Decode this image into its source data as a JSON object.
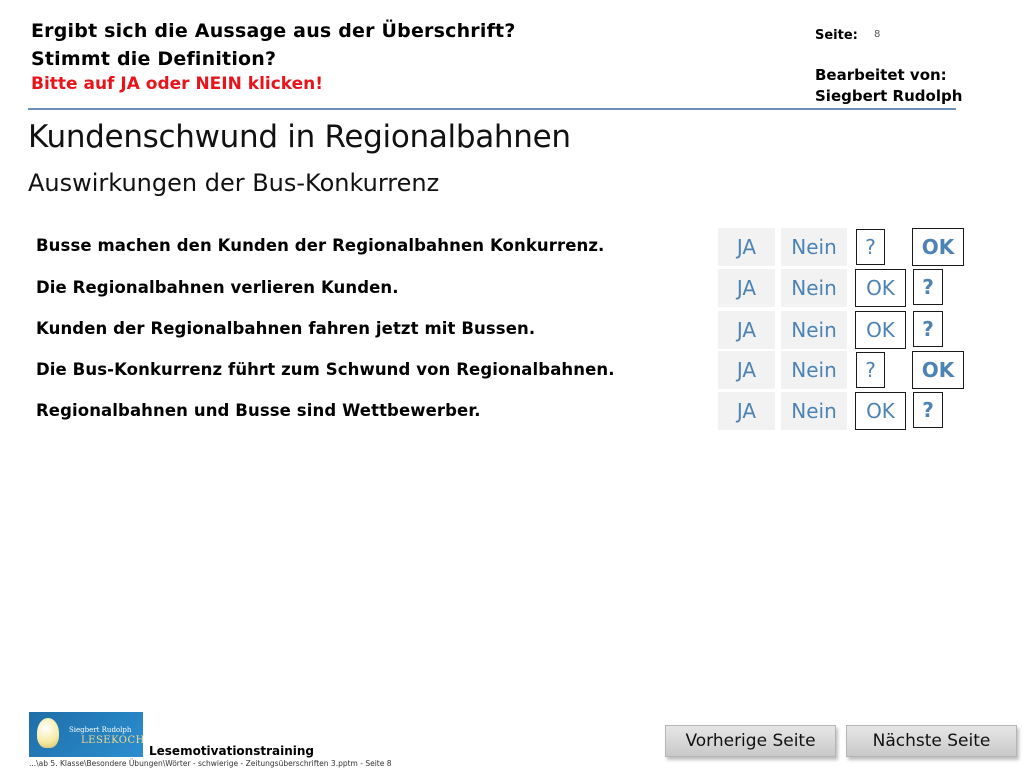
{
  "header": {
    "question1": "Ergibt sich die Aussage aus der Überschrift?",
    "question2": "Stimmt die Definition?",
    "instruction": "Bitte auf JA oder NEIN klicken!",
    "page_label": "Seite:",
    "page_number": "8",
    "edited_by_label": "Bearbeitet von:",
    "edited_by_name": "Siegbert Rudolph"
  },
  "title": "Kundenschwund in Regionalbahnen",
  "subtitle": "Auswirkungen der Bus-Konkurrenz",
  "statements": [
    {
      "text": "Busse machen den Kunden der Regionalbahnen Konkurrenz.",
      "ja": "JA",
      "nein": "Nein",
      "box1": "?",
      "box2": "OK"
    },
    {
      "text": "Die Regionalbahnen verlieren Kunden.",
      "ja": "JA",
      "nein": "Nein",
      "box1": "OK",
      "box2": "?"
    },
    {
      "text": "Kunden der Regionalbahnen fahren jetzt mit Bussen.",
      "ja": "JA",
      "nein": "Nein",
      "box1": "OK",
      "box2": "?"
    },
    {
      "text": "Die Bus-Konkurrenz führt zum Schwund von Regionalbahnen.",
      "ja": "JA",
      "nein": "Nein",
      "box1": "?",
      "box2": "OK"
    },
    {
      "text": "Regionalbahnen und Busse sind Wettbewerber.",
      "ja": "JA",
      "nein": "Nein",
      "box1": "OK",
      "box2": "?"
    }
  ],
  "footer": {
    "logo_line1": "Siegbert Rudolph",
    "logo_line2": "LESEKOCH",
    "label": "Lesemotivationstraining",
    "path": "...\\ab 5. Klasse\\Besondere Übungen\\Wörter - schwierige - Zeitungsüberschriften 3.pptm - Seite 8",
    "prev_button": "Vorherige Seite",
    "next_button": "Nächste Seite"
  },
  "colors": {
    "accent_blue": "#4d83b4",
    "instruction_red": "#e8141b",
    "rule_blue": "#6b8fb8"
  }
}
